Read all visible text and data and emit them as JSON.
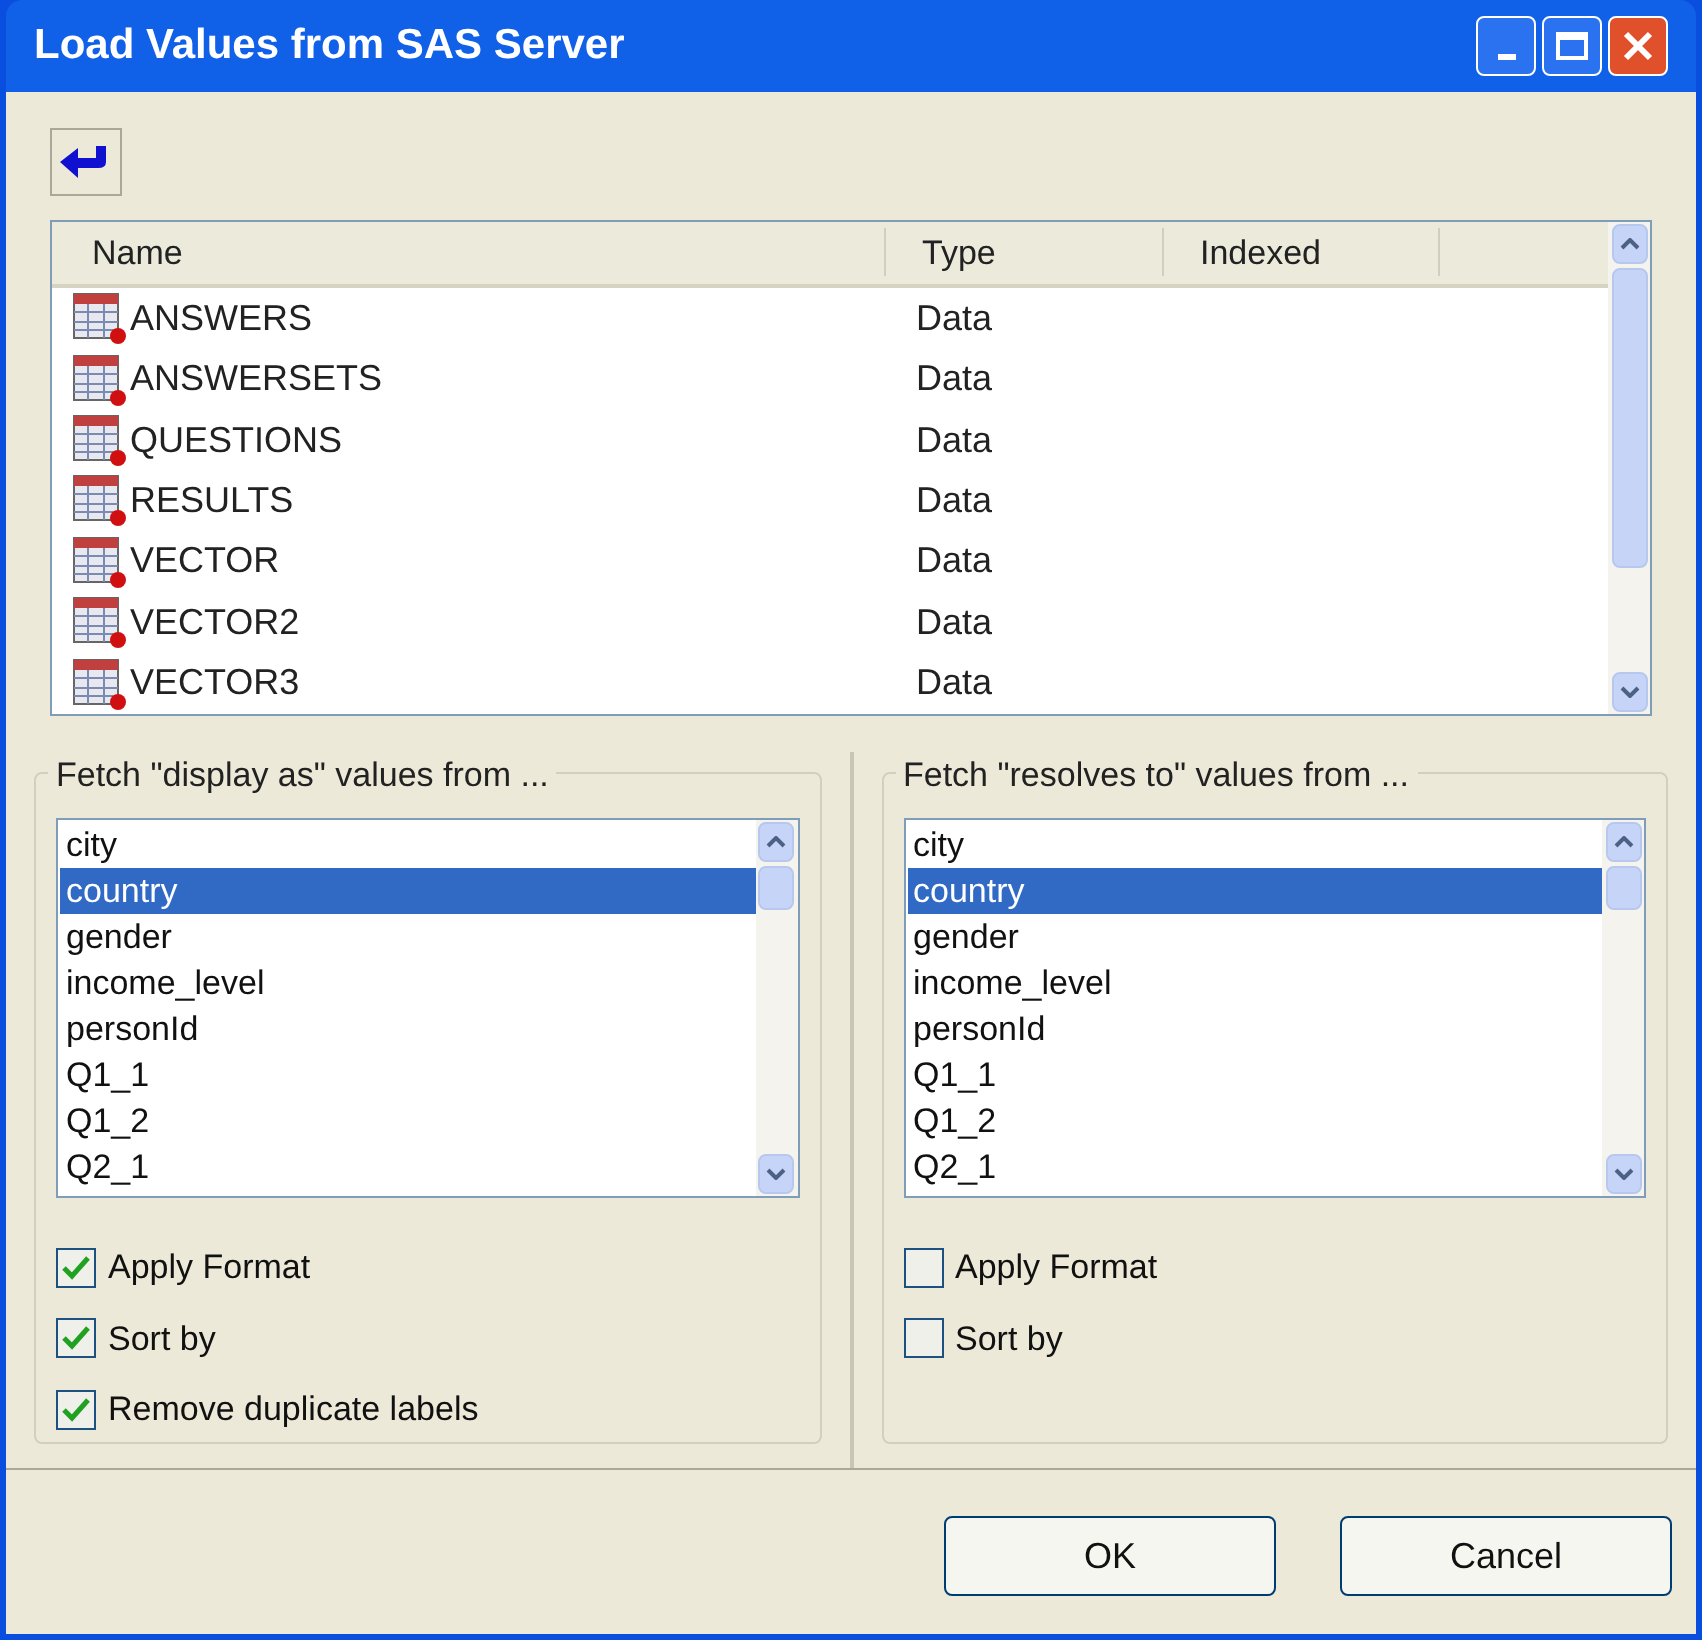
{
  "window": {
    "title": "Load Values from SAS Server"
  },
  "table": {
    "columns": [
      "Name",
      "Type",
      "Indexed"
    ],
    "rows": [
      {
        "name": "ANSWERS",
        "type": "Data"
      },
      {
        "name": "ANSWERSETS",
        "type": "Data"
      },
      {
        "name": "QUESTIONS",
        "type": "Data"
      },
      {
        "name": "RESULTS",
        "type": "Data"
      },
      {
        "name": "VECTOR",
        "type": "Data"
      },
      {
        "name": "VECTOR2",
        "type": "Data"
      },
      {
        "name": "VECTOR3",
        "type": "Data"
      }
    ]
  },
  "groups": [
    {
      "title": "Fetch \"display as\" values from ...",
      "items": [
        {
          "label": "city",
          "selected": false
        },
        {
          "label": "country",
          "selected": true
        },
        {
          "label": "gender",
          "selected": false
        },
        {
          "label": "income_level",
          "selected": false
        },
        {
          "label": "personId",
          "selected": false
        },
        {
          "label": "Q1_1",
          "selected": false
        },
        {
          "label": "Q1_2",
          "selected": false
        },
        {
          "label": "Q2_1",
          "selected": false
        }
      ],
      "options": [
        {
          "label": "Apply Format",
          "checked": true
        },
        {
          "label": "Sort by",
          "checked": true
        },
        {
          "label": "Remove duplicate labels",
          "checked": true
        }
      ]
    },
    {
      "title": "Fetch \"resolves to\" values from ...",
      "items": [
        {
          "label": "city",
          "selected": false
        },
        {
          "label": "country",
          "selected": true
        },
        {
          "label": "gender",
          "selected": false
        },
        {
          "label": "income_level",
          "selected": false
        },
        {
          "label": "personId",
          "selected": false
        },
        {
          "label": "Q1_1",
          "selected": false
        },
        {
          "label": "Q1_2",
          "selected": false
        },
        {
          "label": "Q2_1",
          "selected": false
        }
      ],
      "options": [
        {
          "label": "Apply Format",
          "checked": false
        },
        {
          "label": "Sort by",
          "checked": false
        }
      ]
    }
  ],
  "buttons": [
    "OK",
    "Cancel"
  ]
}
